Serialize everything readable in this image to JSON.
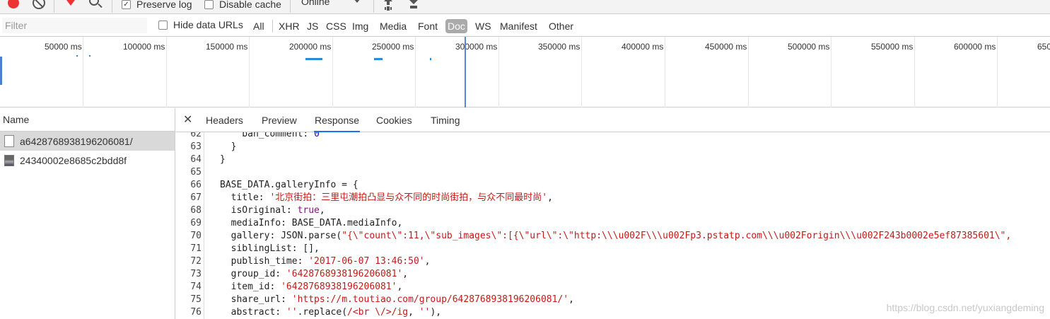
{
  "toolbar": {
    "preserve_log_label": "Preserve log",
    "preserve_log_checked": true,
    "disable_cache_label": "Disable cache",
    "disable_cache_checked": false,
    "throttle_value": "Online"
  },
  "filterbar": {
    "filter_placeholder": "Filter",
    "hide_data_urls_label": "Hide data URLs",
    "types": [
      "All",
      "XHR",
      "JS",
      "CSS",
      "Img",
      "Media",
      "Font",
      "Doc",
      "WS",
      "Manifest",
      "Other"
    ],
    "active_type": "Doc"
  },
  "timeline": {
    "ticks": [
      "50000 ms",
      "100000 ms",
      "150000 ms",
      "200000 ms",
      "250000 ms",
      "300000 ms",
      "350000 ms",
      "400000 ms",
      "450000 ms",
      "500000 ms",
      "550000 ms",
      "600000 ms",
      "650"
    ]
  },
  "name_panel": {
    "header": "Name",
    "rows": [
      {
        "name": "a6428768938196206081/",
        "type": "doc"
      },
      {
        "name": "24340002e8685c2bdd8f",
        "type": "img"
      }
    ]
  },
  "detail": {
    "tabs": [
      "Headers",
      "Preview",
      "Response",
      "Cookies",
      "Timing"
    ],
    "active_tab": "Response"
  },
  "code_lines": [
    {
      "n": "62",
      "html": "    ban_comment: <span class=\"num\">0</span>"
    },
    {
      "n": "63",
      "html": "  }"
    },
    {
      "n": "64",
      "html": "}"
    },
    {
      "n": "65",
      "html": ""
    },
    {
      "n": "66",
      "html": "BASE_DATA.galleryInfo = {"
    },
    {
      "n": "67",
      "html": "  title: <span class=\"str\">'北京街拍：三里屯潮拍凸显与众不同的时尚街拍，与众不同最时尚'</span>,"
    },
    {
      "n": "68",
      "html": "  isOriginal: <span class=\"kw\">true</span>,"
    },
    {
      "n": "69",
      "html": "  mediaInfo: BASE_DATA.mediaInfo,"
    },
    {
      "n": "70",
      "html": "  gallery: JSON.parse(<span class=\"str\">\"{\\\"count\\\":11,\\\"sub_images\\\":[{\\\"url\\\":\\\"http:\\\\\\u002F\\\\\\u002Fp3.pstatp.com\\\\\\u002Forigin\\\\\\u002F243b0002e5ef87385601\\\",</span>"
    },
    {
      "n": "71",
      "html": "  siblingList: [],"
    },
    {
      "n": "72",
      "html": "  publish_time: <span class=\"str\">'2017-06-07 13:46:50'</span>,"
    },
    {
      "n": "73",
      "html": "  group_id: <span class=\"str\">'6428768938196206081'</span>,"
    },
    {
      "n": "74",
      "html": "  item_id: <span class=\"str\">'6428768938196206081'</span>,"
    },
    {
      "n": "75",
      "html": "  share_url: <span class=\"str\">'https://m.toutiao.com/group/6428768938196206081/'</span>,"
    },
    {
      "n": "76",
      "html": "  abstract: <span class=\"str\">''</span>.replace(<span class=\"str\">/&lt;br \\/&gt;/ig</span>, <span class=\"str\">''</span>),"
    }
  ],
  "watermark": "https://blog.csdn.net/yuxiangdeming"
}
